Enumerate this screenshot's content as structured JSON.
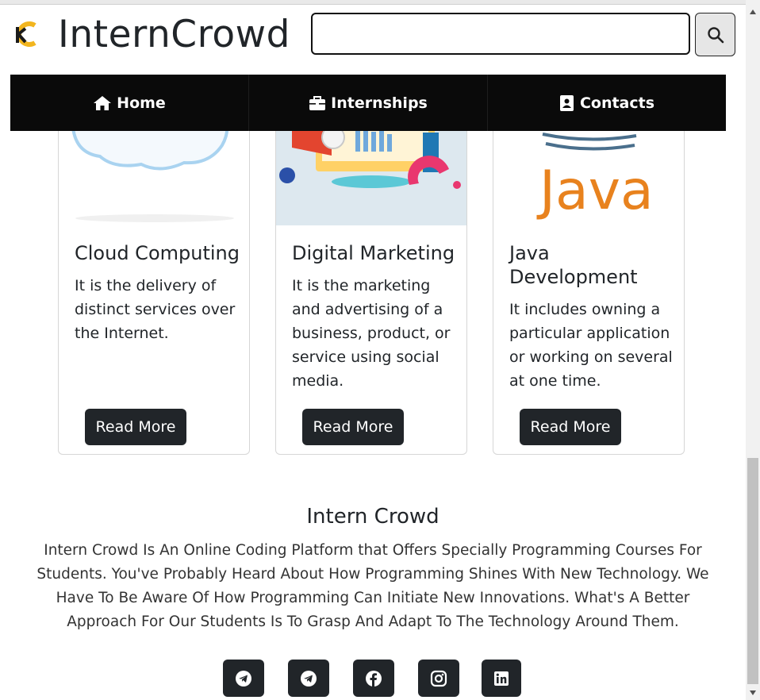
{
  "header": {
    "brand": "InternCrowd",
    "search": {
      "value": "",
      "placeholder": ""
    }
  },
  "nav": {
    "items": [
      {
        "label": "Home",
        "icon": "home-icon"
      },
      {
        "label": "Internships",
        "icon": "briefcase-icon"
      },
      {
        "label": "Contacts",
        "icon": "contact-book-icon"
      }
    ]
  },
  "cards": [
    {
      "title": "Cloud Computing",
      "text": "It is the delivery of distinct services over the Internet.",
      "button": "Read More"
    },
    {
      "title": "Digital Marketing",
      "text": "It is the marketing and advertising of a business, product, or service using social media.",
      "button": "Read More"
    },
    {
      "title": "Java Development",
      "text": "It includes owning a particular application or working on several at one time.",
      "button": "Read More",
      "image_text": "Java"
    }
  ],
  "footer": {
    "title": "Intern Crowd",
    "text": "Intern Crowd Is An Online Coding Platform that Offers Specially Programming Courses For Students. You've Probably Heard About How Programming Shines With New Technology. We Have To Be Aware Of How Programming Can Initiate New Innovations. What's A Better Approach For Our Students Is To Grasp And Adapt To The Technology Around Them.",
    "social": [
      "telegram-icon",
      "telegram-icon",
      "facebook-icon",
      "instagram-icon",
      "linkedin-icon"
    ]
  },
  "colors": {
    "nav_bg": "#0a0a0a",
    "button_bg": "#212529",
    "java_orange": "#e8821e",
    "java_blue": "#4a6f8c"
  }
}
